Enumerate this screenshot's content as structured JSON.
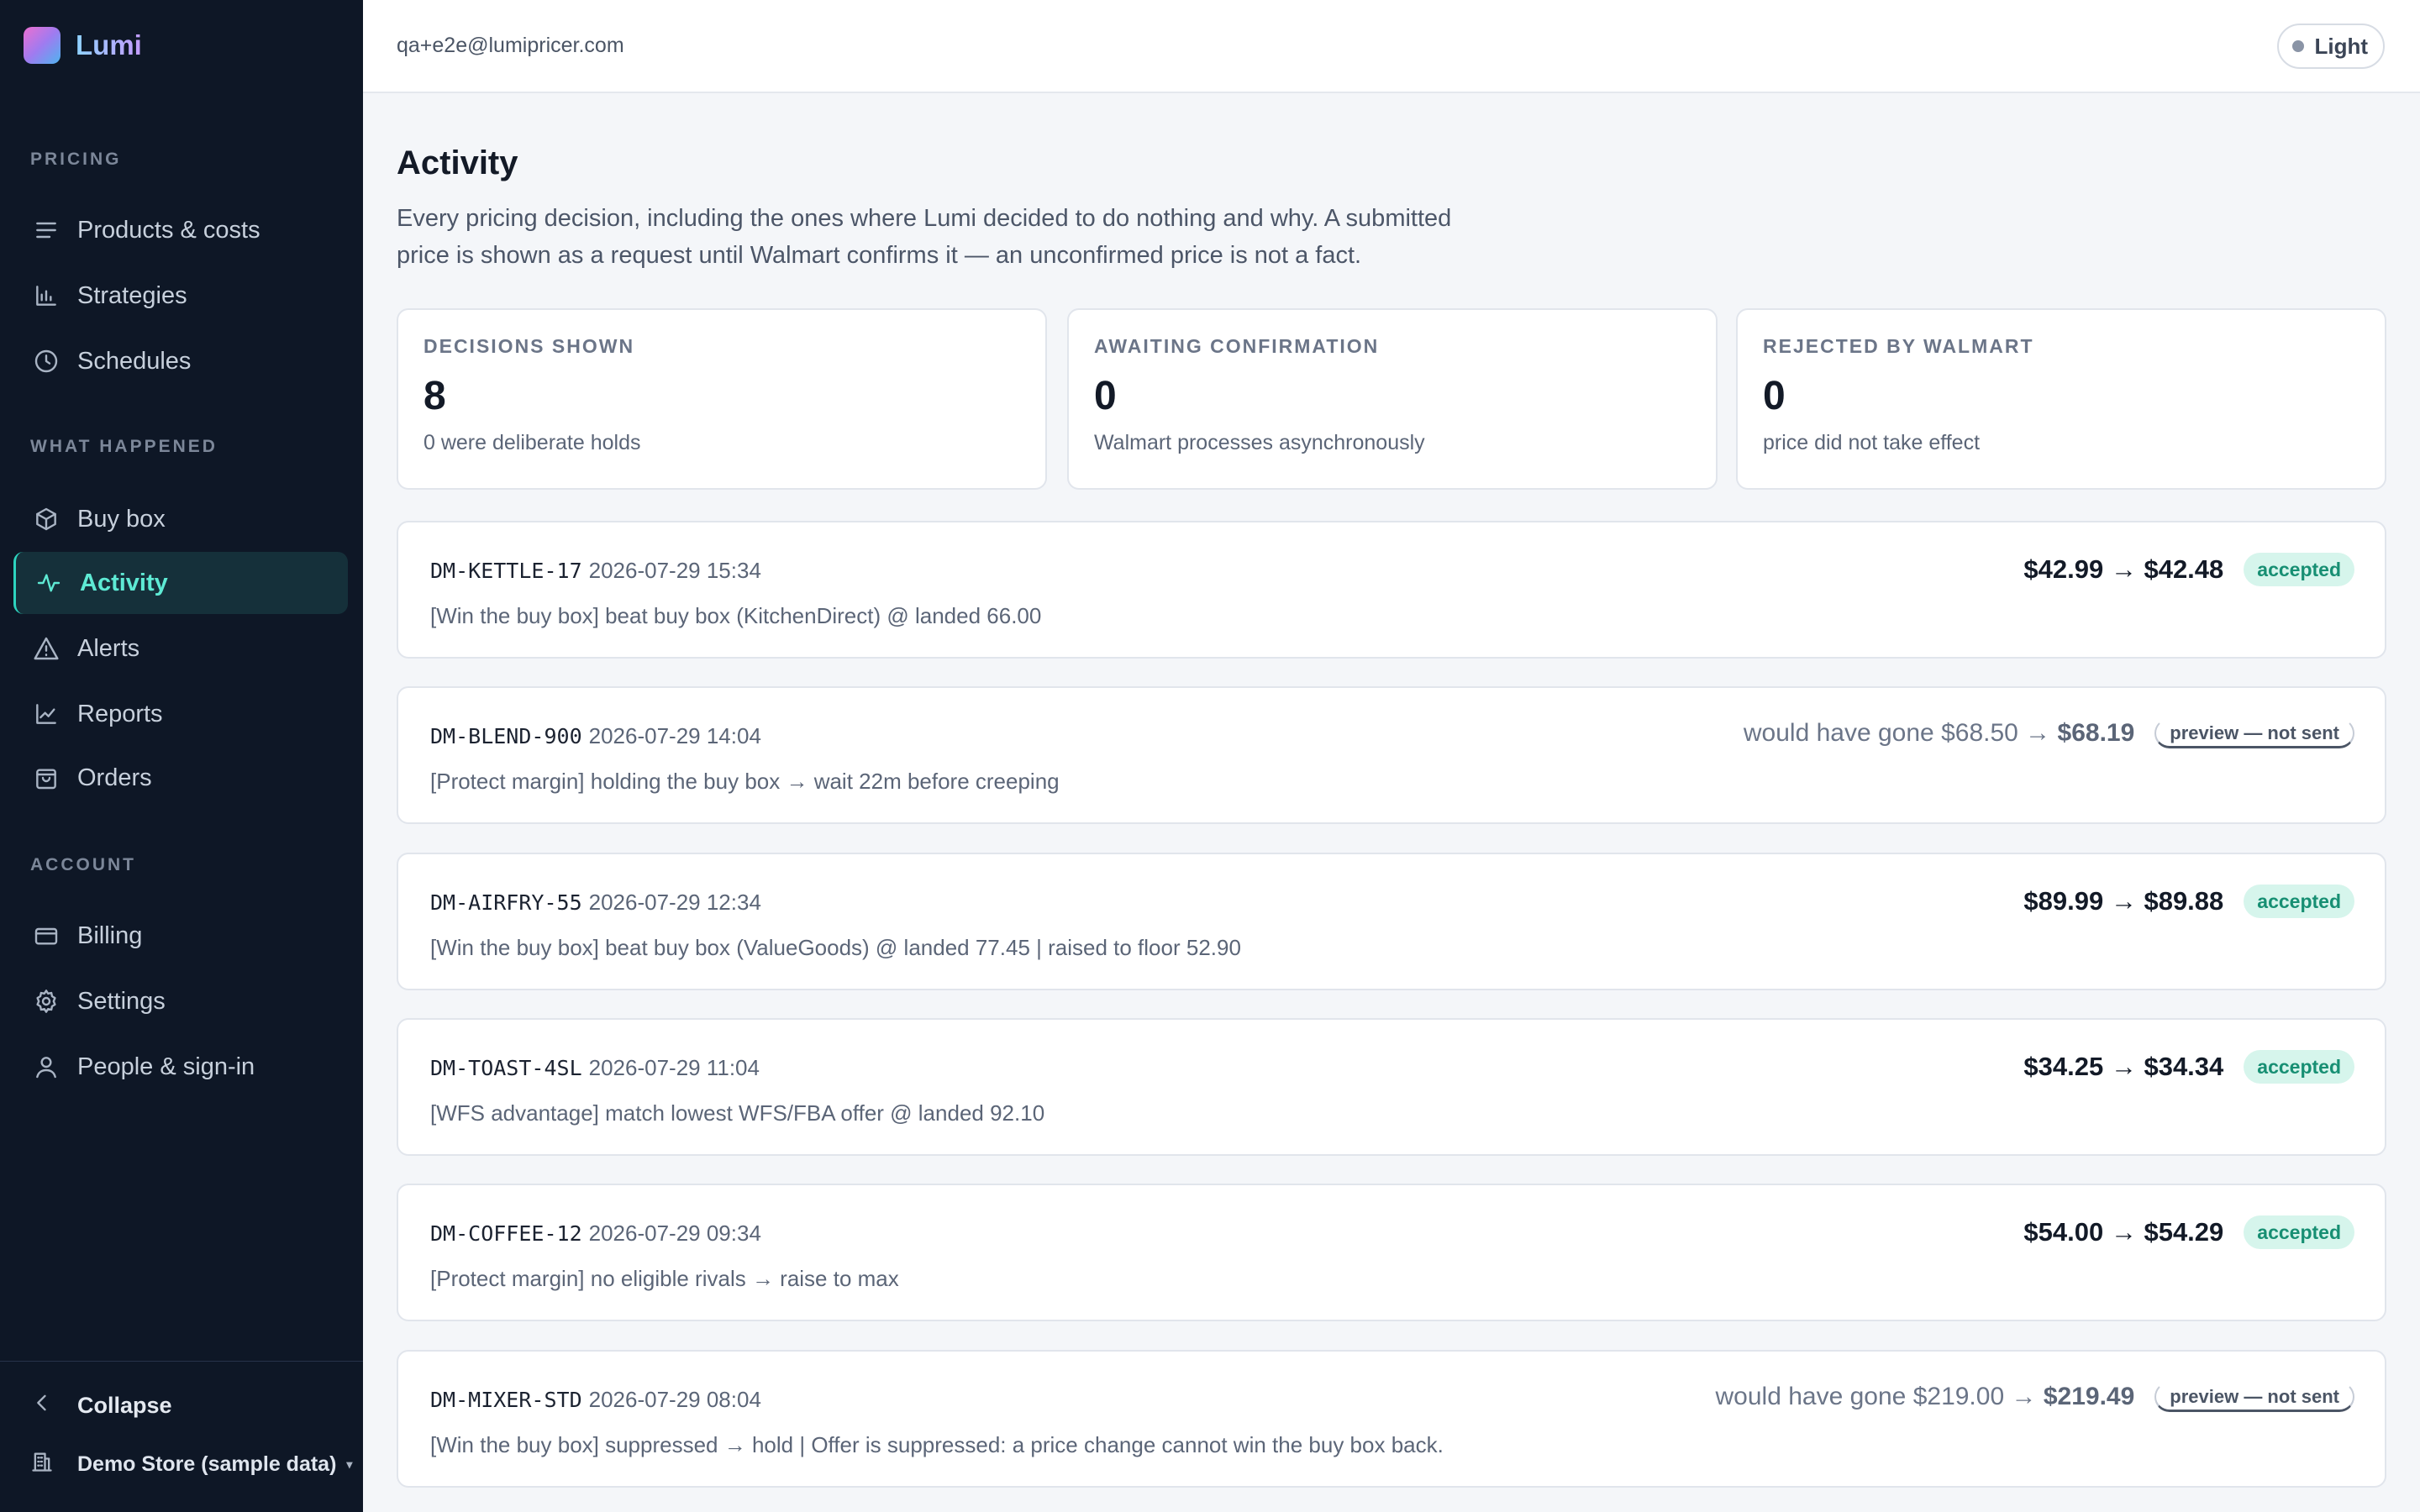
{
  "app": {
    "name": "Lumi"
  },
  "sidebar": {
    "sections": [
      {
        "label": "PRICING"
      },
      {
        "label": "WHAT HAPPENED"
      },
      {
        "label": "ACCOUNT"
      }
    ],
    "items": [
      {
        "label": "Products & costs",
        "icon": "list-icon"
      },
      {
        "label": "Strategies",
        "icon": "bar-chart-icon"
      },
      {
        "label": "Schedules",
        "icon": "clock-icon"
      },
      {
        "label": "Buy box",
        "icon": "box-icon"
      },
      {
        "label": "Activity",
        "icon": "pulse-icon",
        "active": true
      },
      {
        "label": "Alerts",
        "icon": "warning-icon"
      },
      {
        "label": "Reports",
        "icon": "line-chart-icon"
      },
      {
        "label": "Orders",
        "icon": "shopping-bag-icon"
      },
      {
        "label": "Billing",
        "icon": "credit-card-icon"
      },
      {
        "label": "Settings",
        "icon": "gear-icon"
      },
      {
        "label": "People & sign-in",
        "icon": "user-icon"
      }
    ],
    "collapse_label": "Collapse",
    "store_label": "Demo Store (sample data)"
  },
  "header": {
    "email": "qa+e2e@lumipricer.com",
    "theme_label": "Light"
  },
  "main": {
    "title": "Activity",
    "description": "Every pricing decision, including the ones where Lumi decided to do nothing and why. A submitted price is shown as a request until Walmart confirms it — an unconfirmed price is not a fact.",
    "stats": [
      {
        "label": "DECISIONS SHOWN",
        "value": "8",
        "sub": "0 were deliberate holds"
      },
      {
        "label": "AWAITING CONFIRMATION",
        "value": "0",
        "sub": "Walmart processes asynchronously"
      },
      {
        "label": "REJECTED BY WALMART",
        "value": "0",
        "sub": "price did not take effect"
      }
    ],
    "decisions": [
      {
        "id": "DM-KETTLE-17",
        "time": "2026-07-29 15:34",
        "reason": "[Win the buy box] beat buy box (KitchenDirect) @ landed 66.00",
        "price": "$42.99 → $42.48",
        "badge": "accepted"
      },
      {
        "id": "DM-BLEND-900",
        "time": "2026-07-29 14:04",
        "reason": "[Protect margin] holding the buy box → wait 22m before creeping",
        "would_prefix": "would have gone $68.50 →",
        "would_to": "$68.19",
        "badge": "preview — not sent"
      },
      {
        "id": "DM-AIRFRY-55",
        "time": "2026-07-29 12:34",
        "reason": "[Win the buy box] beat buy box (ValueGoods) @ landed 77.45 | raised to floor 52.90",
        "price": "$89.99 → $89.88",
        "badge": "accepted"
      },
      {
        "id": "DM-TOAST-4SL",
        "time": "2026-07-29 11:04",
        "reason": "[WFS advantage] match lowest WFS/FBA offer @ landed 92.10",
        "price": "$34.25 → $34.34",
        "badge": "accepted"
      },
      {
        "id": "DM-COFFEE-12",
        "time": "2026-07-29 09:34",
        "reason": "[Protect margin] no eligible rivals → raise to max",
        "price": "$54.00 → $54.29",
        "badge": "accepted"
      },
      {
        "id": "DM-MIXER-STD",
        "time": "2026-07-29 08:04",
        "reason": "[Win the buy box] suppressed → hold | Offer is suppressed: a price change cannot win the buy box back.",
        "would_prefix": "would have gone $219.00 →",
        "would_to": "$219.49",
        "badge": "preview — not sent"
      }
    ]
  }
}
